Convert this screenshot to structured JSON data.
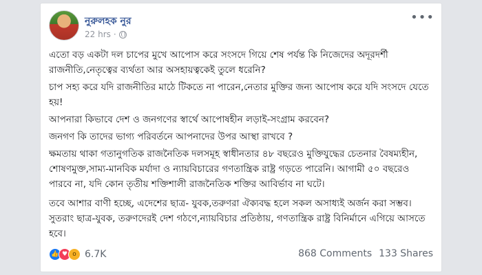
{
  "post": {
    "author": "নুরুলহক নুর",
    "time": "22 hrs",
    "privacy_icon": "globe-icon",
    "paragraphs": [
      "এতো বড় একটা দল চাপের মুখে আপোস করে সংসদে গিয়ে শেষ পর্যন্ত কি নিজেদের অদূরদর্শী রাজনীতি,নেতৃত্বের ব্যর্থতা আর অসহায়ত্বকেই তুলে ধরেনি?",
      "চাপ সহ্য করে যদি রাজনীতির মাঠে টিকতে না পারেন,নেতার মুক্তির জন্য আপোষ করে যদি সংসদে যেতে হয়!",
      "আপনারা কিভাবে দেশ ও জনগণের স্বার্থে আপোষহীন লড়াই-সংগ্রাম করবেন?",
      "জনগণ কি তাদের ভাগ্য পরিবর্তনে আপনাদের উপর আস্থা রাখবে ?",
      "ক্ষমতায় থাকা গতানুগতিক রাজনৈতিক দলসমূহ স্বাধীনতার ৪৮ বছরেও মুক্তিযুদ্ধের চেতনার বৈষম্যহীন, শোষণমুক্ত,সাম্য-মানবিক মর্যাদা ও ন্যায়বিচারের গণতান্ত্রিক রাষ্ট্র গড়তে পারেনি। আগামী ৫০ বছরেও পারবে না, যদি কোন তৃতীয় শক্তিশালী রাজনৈতিক শক্তির আবির্ভাব না ঘটে।",
      "তবে আশার বাণী হচ্ছে, এদেশের ছাত্র- যুবক,তরুণরা ঐক্যবদ্ধ হলে সকল অসাধ্যই অর্জন করা সম্ভব। সুতরাং ছাত্র-যুবক, তরুণদেরই দেশ গঠণে,ন্যায়বিচার প্রতিষ্ঠায়, গণতান্ত্রিক রাষ্ট্র বিনির্মানে এগিয়ে আসতে হবে।"
    ]
  },
  "reactions": {
    "icons": [
      "like-icon",
      "love-icon",
      "wow-icon"
    ],
    "count": "6.7K"
  },
  "stats": {
    "comments": "868 Comments",
    "shares": "133 Shares"
  },
  "colors": {
    "author": "#385898",
    "like": "#1877f2",
    "love": "#f33e58",
    "wow": "#f7b125"
  }
}
